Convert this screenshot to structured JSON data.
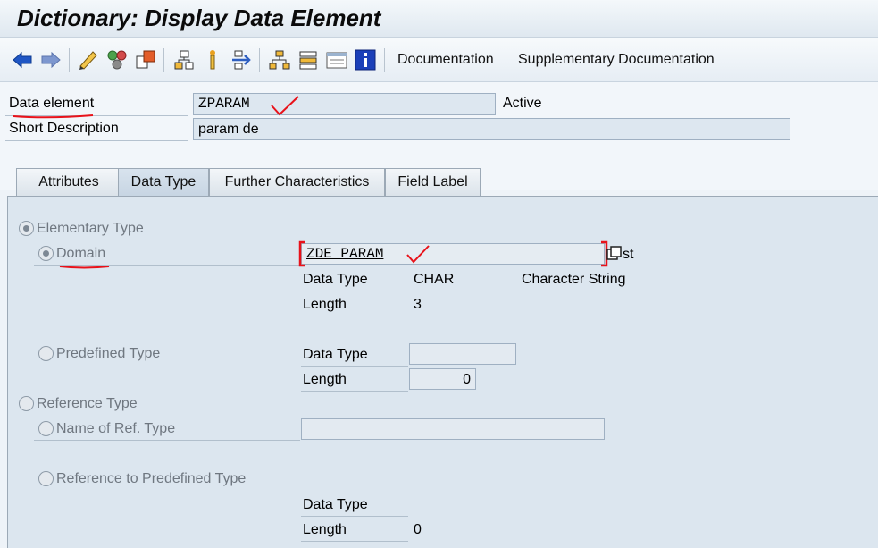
{
  "window": {
    "title": "Dictionary: Display Data Element"
  },
  "toolbar": {
    "icons": [
      "back-arrow-icon",
      "forward-arrow-icon",
      "edit-pencil-icon",
      "other-object-icon",
      "display-change-icon",
      "hierarchy-up-icon",
      "where-used-icon",
      "navigate-icon",
      "hierarchy-icon",
      "stack-icon",
      "list-icon",
      "info-icon"
    ],
    "documentation_label": "Documentation",
    "supplementary_label": "Supplementary Documentation"
  },
  "header": {
    "data_element_label": "Data element",
    "data_element_value": "ZPARAM",
    "status": "Active",
    "short_desc_label": "Short Description",
    "short_desc_value": "param de"
  },
  "tabs": [
    {
      "label": "Attributes",
      "active": false
    },
    {
      "label": "Data Type",
      "active": true
    },
    {
      "label": "Further Characteristics",
      "active": false
    },
    {
      "label": "Field Label",
      "active": false
    }
  ],
  "data_type": {
    "elementary_label": "Elementary Type",
    "domain_label": "Domain",
    "domain_value": "ZDE PARAM",
    "domain_trailing": "st",
    "dt_label": "Data Type",
    "dt_value": "CHAR",
    "dt_desc": "Character String",
    "len_label": "Length",
    "len_value": "3",
    "predefined_label": "Predefined Type",
    "pre_dt_label": "Data Type",
    "pre_dt_value": "",
    "pre_len_label": "Length",
    "pre_len_value": "0",
    "reference_label": "Reference Type",
    "ref_name_label": "Name of Ref. Type",
    "ref_name_value": "",
    "ref_predef_label": "Reference to Predefined Type",
    "ref_dt_label": "Data Type",
    "ref_len_label": "Length",
    "ref_len_value": "0"
  },
  "colors": {
    "annotation_red": "#e8121a",
    "panel_bg": "#dce6ef"
  }
}
